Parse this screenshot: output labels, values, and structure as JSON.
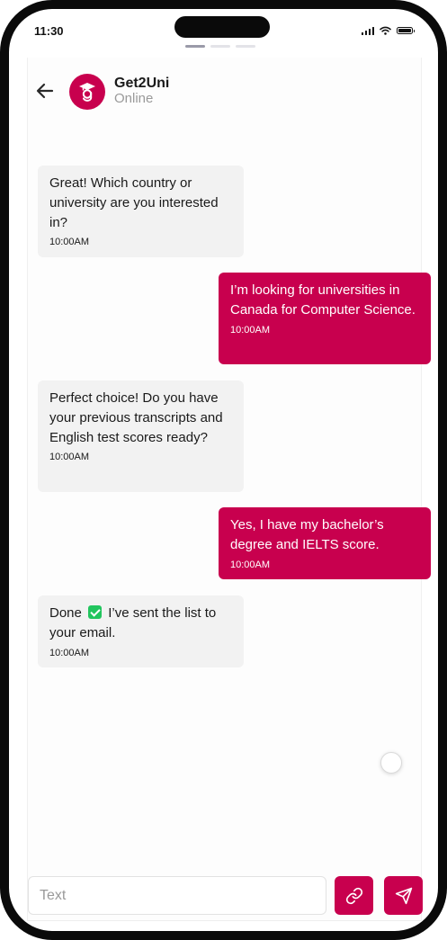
{
  "status_bar": {
    "time": "11:30"
  },
  "header": {
    "name": "Get2Uni",
    "status": "Online"
  },
  "messages": [
    {
      "direction": "incoming",
      "text": "Great! Which country or university are you interested in?",
      "time": "10:00AM"
    },
    {
      "direction": "outgoing",
      "text": "I’m looking for universities in Canada for Computer Science.",
      "time": "10:00AM"
    },
    {
      "direction": "incoming",
      "text": "Perfect choice! Do you have your previous transcripts and English test scores ready?",
      "time": "10:00AM"
    },
    {
      "direction": "outgoing",
      "text": "Yes, I have my bachelor’s degree and IELTS score.",
      "time": "10:00AM"
    },
    {
      "direction": "incoming",
      "text_before": "Done",
      "text_after": "I’ve sent the list to your email.",
      "time": "10:00AM"
    }
  ],
  "composer": {
    "placeholder": "Text"
  },
  "colors": {
    "brand": "#c8004e",
    "incoming_bubble": "#f2f2f2",
    "check": "#22c55e"
  },
  "icons": [
    "back-arrow-icon",
    "graduation-logo-icon",
    "link-icon",
    "send-icon",
    "check-mark-icon"
  ]
}
